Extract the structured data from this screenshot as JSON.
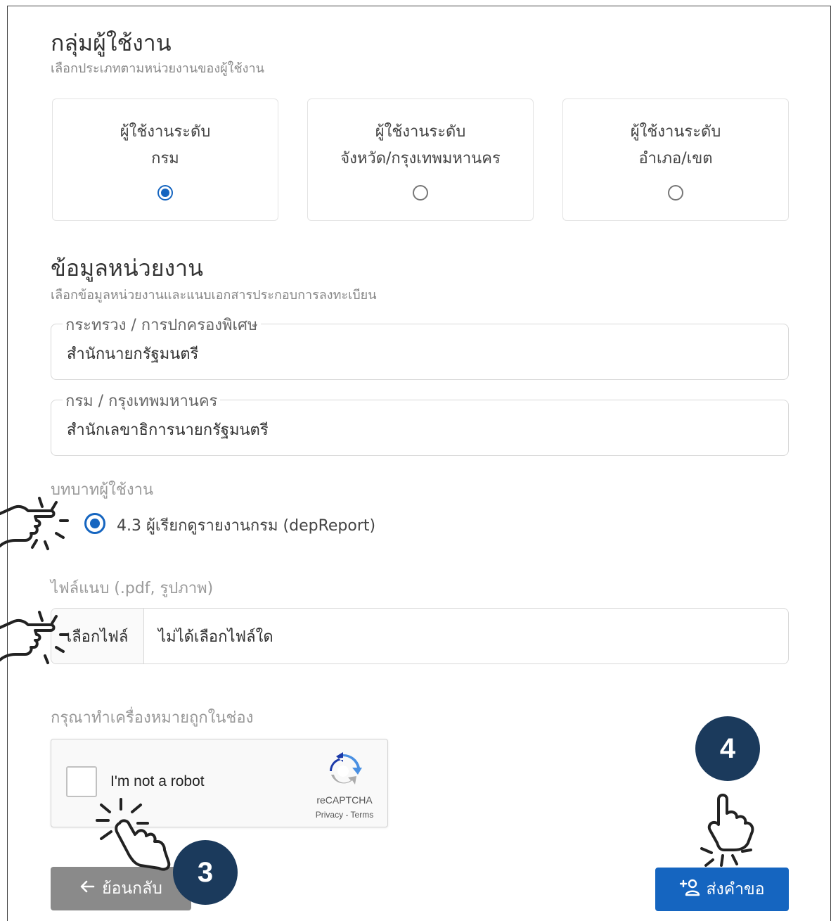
{
  "user_group": {
    "title": "กลุ่มผู้ใช้งาน",
    "subtitle": "เลือกประเภทตามหน่วยงานของผู้ใช้งาน",
    "options": [
      {
        "line1": "ผู้ใช้งานระดับ",
        "line2": "กรม",
        "selected": true
      },
      {
        "line1": "ผู้ใช้งานระดับ",
        "line2": "จังหวัด/กรุงเทพมหานคร",
        "selected": false
      },
      {
        "line1": "ผู้ใช้งานระดับ",
        "line2": "อำเภอ/เขต",
        "selected": false
      }
    ]
  },
  "agency": {
    "title": "ข้อมูลหน่วยงาน",
    "subtitle": "เลือกข้อมูลหน่วยงานและแนบเอกสารประกอบการลงทะเบียน",
    "ministry_label": "กระทรวง / การปกครองพิเศษ",
    "ministry_value": "สำนักนายกรัฐมนตรี",
    "department_label": "กรม / กรุงเทพมหานคร",
    "department_value": "สำนักเลขาธิการนายกรัฐมนตรี"
  },
  "role": {
    "label": "บทบาทผู้ใช้งาน",
    "option": "4.3 ผู้เรียกดูรายงานกรม (depReport)"
  },
  "attachment": {
    "label": "ไฟล์แนบ (.pdf, รูปภาพ)",
    "button": "เลือกไฟล์",
    "status": "ไม่ได้เลือกไฟล์ใด"
  },
  "captcha": {
    "label": "กรุณาทำเครื่องหมายถูกในช่อง",
    "text": "I'm not a robot",
    "brand": "reCAPTCHA",
    "links": "Privacy - Terms"
  },
  "buttons": {
    "back": "ย้อนกลับ",
    "submit": "ส่งคำขอ"
  },
  "steps": {
    "three": "3",
    "four": "4"
  },
  "colors": {
    "primary": "#1565c0",
    "back_button": "#8a8a8a",
    "step_badge": "#1b3a5c"
  }
}
